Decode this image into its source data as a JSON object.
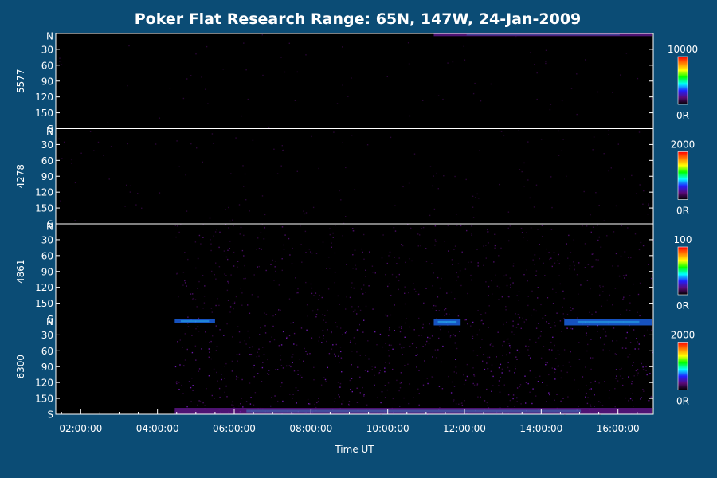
{
  "chart_data": {
    "type": "heatmap",
    "title": "Poker Flat Research Range: 65N, 147W, 24-Jan-2009",
    "xlabel": "Time UT",
    "x_tick_labels": [
      "02:00:00",
      "04:00:00",
      "06:00:00",
      "08:00:00",
      "10:00:00",
      "12:00:00",
      "14:00:00",
      "16:00:00"
    ],
    "x_tick_hours": [
      2,
      4,
      6,
      8,
      10,
      12,
      14,
      16
    ],
    "xlim_hours": [
      1.35,
      16.92
    ],
    "y_tick_labels": [
      "N",
      "30",
      "60",
      "90",
      "120",
      "150",
      "S"
    ],
    "y_tick_values": [
      0,
      30,
      60,
      90,
      120,
      150,
      180
    ],
    "ylim": [
      0,
      180
    ],
    "colorscale": [
      "#000000",
      "#5a0a78",
      "#2020ff",
      "#00ffff",
      "#00ff00",
      "#ffff00",
      "#ff8000",
      "#ff0000"
    ],
    "panels": [
      {
        "ylabel": "5577",
        "colorbar_max": "10000",
        "colorbar_min": "0R",
        "data_start_hour": 1.35,
        "noise_level": 0.03,
        "features": [
          {
            "t_start": 11.2,
            "t_end": 16.9,
            "y_start": 0,
            "y_end": 5,
            "intensity": 0.25
          }
        ]
      },
      {
        "ylabel": "4278",
        "colorbar_max": "2000",
        "colorbar_min": "0R",
        "data_start_hour": 1.35,
        "noise_level": 0.06,
        "features": []
      },
      {
        "ylabel": "4861",
        "colorbar_max": "100",
        "colorbar_min": "0R",
        "data_start_hour": 4.45,
        "noise_level": 0.22,
        "features": []
      },
      {
        "ylabel": "6300",
        "colorbar_max": "2000",
        "colorbar_min": "0R",
        "data_start_hour": 4.45,
        "noise_level": 0.32,
        "features": [
          {
            "t_start": 4.45,
            "t_end": 5.5,
            "y_start": 0,
            "y_end": 8,
            "intensity": 0.4
          },
          {
            "t_start": 11.2,
            "t_end": 11.9,
            "y_start": 0,
            "y_end": 12,
            "intensity": 0.45
          },
          {
            "t_start": 14.6,
            "t_end": 16.9,
            "y_start": 0,
            "y_end": 12,
            "intensity": 0.4
          },
          {
            "t_start": 4.45,
            "t_end": 16.9,
            "y_start": 168,
            "y_end": 180,
            "intensity": 0.3
          }
        ]
      }
    ]
  }
}
